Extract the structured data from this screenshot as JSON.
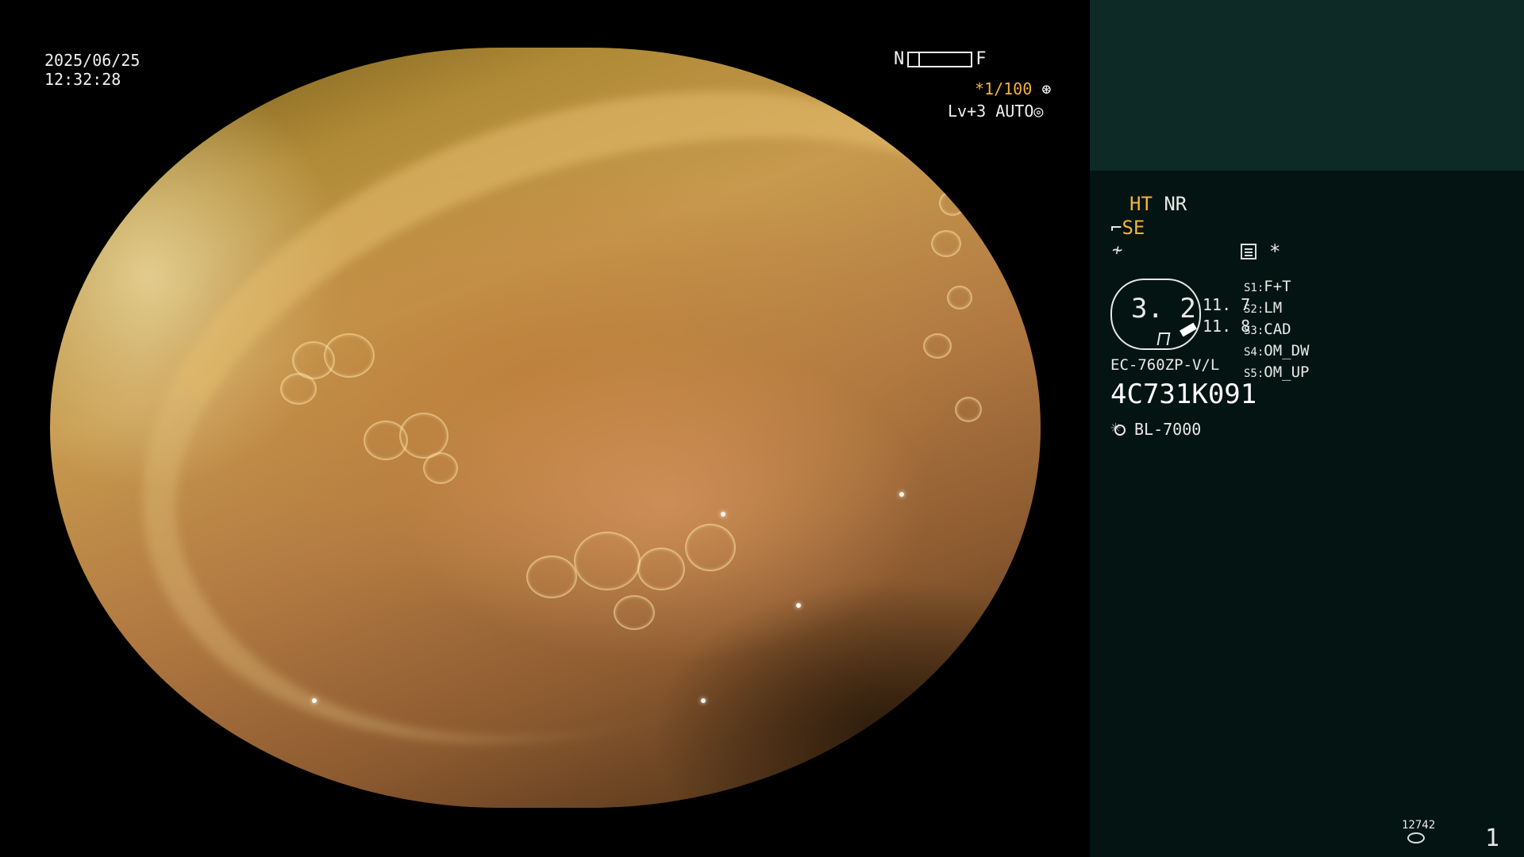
{
  "view": {
    "date": "2025/06/25",
    "time": "12:32:28",
    "nf": {
      "near_label": "N",
      "far_label": "F"
    },
    "shutter": {
      "prefix": "*",
      "value": "1/100",
      "icon": "shutter-icon"
    },
    "level": {
      "text": "Lv+3",
      "mode": "AUTO",
      "icon": "auto-iris-icon"
    }
  },
  "info": {
    "mode_ht": "HT",
    "mode_nr": "NR",
    "se_label": "SE",
    "se_icon": "pipe-icon",
    "mark_icon": "mark-icon",
    "doc_icon": "document-icon",
    "star": "*",
    "scope_size": "3. 2",
    "value_1": "11. 7",
    "value_2": "11. 8",
    "switches": [
      {
        "key": "S1",
        "value": "F+T"
      },
      {
        "key": "S2",
        "value": "LM"
      },
      {
        "key": "S3",
        "value": "CAD"
      },
      {
        "key": "S4",
        "value": "OM_DW"
      },
      {
        "key": "S5",
        "value": "OM_UP"
      }
    ],
    "scope_model": "EC-760ZP-V/L",
    "serial": "4C731K091",
    "light_source": "BL-7000",
    "light_icon": "sun-icon",
    "storage_count": "12742",
    "page_number": "1"
  },
  "colors": {
    "accent_amber": "#f1b43a",
    "panel_bg": "#031412",
    "panel_top_bg": "#0d2a27"
  }
}
